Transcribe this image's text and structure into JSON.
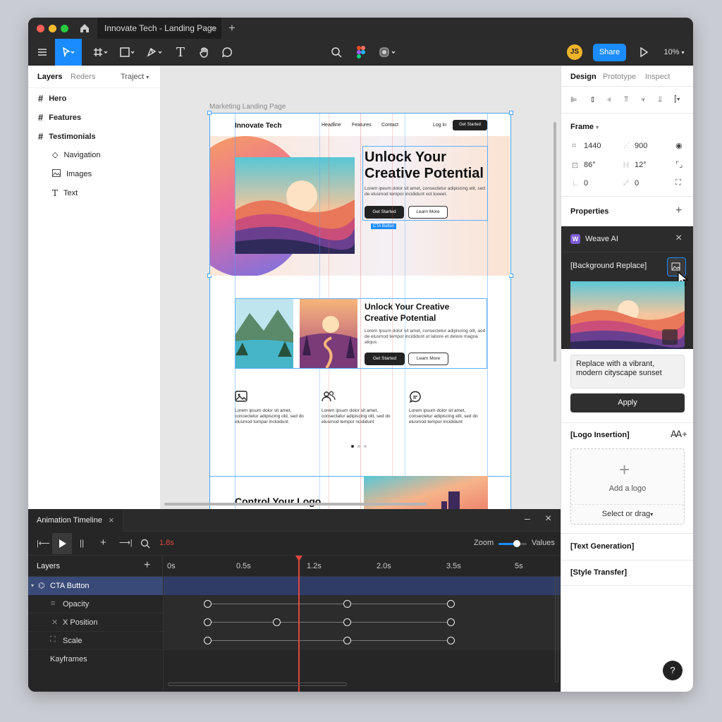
{
  "window": {
    "tab_title": "Innovate Tech - Landing Page",
    "avatar_initials": "JS",
    "share_label": "Share",
    "zoom_level": "10%"
  },
  "left_panel": {
    "tabs": [
      "Layers",
      "Reders",
      "Traject"
    ],
    "items": [
      {
        "label": "Hero",
        "icon": "hash-icon",
        "bold": true
      },
      {
        "label": "Features",
        "icon": "hash-icon",
        "bold": true
      },
      {
        "label": "Testimonials",
        "icon": "hash-icon",
        "bold": true
      },
      {
        "label": "Navigation",
        "icon": "component-icon"
      },
      {
        "label": "Images",
        "icon": "image-icon"
      },
      {
        "label": "Text",
        "icon": "text-icon"
      }
    ]
  },
  "canvas": {
    "frame_label": "Marketing Landing Page",
    "site": {
      "logo": "Innovate Tech",
      "nav": [
        "Headline",
        "Features",
        "Contact"
      ],
      "login": "Log in",
      "cta": "Get Started",
      "hero_title_1": "Unlock Your",
      "hero_title_2": "Creative Potential",
      "hero_body": "Lorem ipeum dolor sit amet, consectetur adipiscing elit, sed de elusmod tempor incididunt xot tooeet.",
      "btn_primary": "Get Started",
      "btn_secondary": "Learn More",
      "cta_tag": "CTA Button",
      "feature_title_1": "Unlock Your Creative",
      "feature_title_2": "Creative Potential",
      "feature_body": "Lorem Ipsum dolor sit amet, consectetur adipiscing olit, aod de elusmod tempor incididunt ut labore et delore magna aliqus.",
      "columns": [
        {
          "icon": "image-icon",
          "text": "Lorem ipsum dolor sit amet, concectetur adipiscing old, sed do elusmod tompar incloidunt"
        },
        {
          "icon": "users-icon",
          "text": "Lorem ipsum dolor sit amet, consectatur adipiscing olit, sed do elusmod tempor ncididunt"
        },
        {
          "icon": "chat-icon",
          "text": "Lorem ipsum dolor sit amet, consectetur adipiscing elit, sed do elusmod tempor incididunt"
        }
      ],
      "logo_section_title": "Control Your Logo"
    }
  },
  "right_panel": {
    "tabs": [
      "Design",
      "Prototype",
      "Inspect"
    ],
    "frame": {
      "title": "Frame",
      "w": "1440",
      "h": "900",
      "rot": "86°",
      "radius": "12°",
      "x": "0",
      "y": "0"
    },
    "properties": "Properties",
    "weave": {
      "title": "Weave AI",
      "bg_replace": "[Background Replace]",
      "prompt": "Replace with a vibrant, modern cityscape sunset",
      "apply": "Apply",
      "logo_insertion": "[Logo Insertion]",
      "add_logo": "Add a logo",
      "select": "Select or drag",
      "text_gen": "[Text Generation]",
      "style_transfer": "[Style Transfer]"
    },
    "help": "?"
  },
  "timeline": {
    "title": "Animation Timeline",
    "time": "1.8s",
    "zoom_label": "Zoom",
    "zoom_level": 0.65,
    "values_label": "Values",
    "layers_label": "Layers",
    "ruler": [
      "0s",
      "0.5s",
      "1.2s",
      "2.0s",
      "3.5s",
      "5s"
    ],
    "tracks": [
      {
        "name": "CTA Button",
        "icon": "component-icon",
        "selected": true
      },
      {
        "name": "Opacity",
        "icon": "lines-icon"
      },
      {
        "name": "X Position",
        "icon": "x-icon"
      },
      {
        "name": "Scale",
        "icon": "scale-icon"
      },
      {
        "name": "Kayframes",
        "icon": ""
      }
    ]
  },
  "colors": {
    "accent": "#1a8cff",
    "playhead": "#e0463c",
    "selection": "#3b5998",
    "dark": "#1e1e1e"
  }
}
